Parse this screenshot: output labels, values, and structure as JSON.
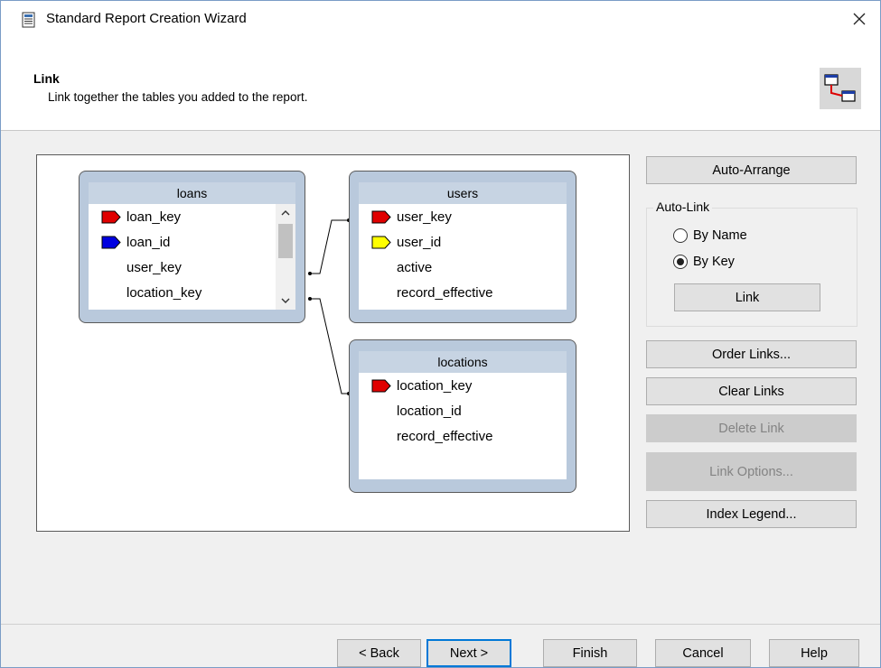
{
  "window": {
    "title": "Standard Report Creation Wizard"
  },
  "header": {
    "title": "Link",
    "subtitle": "Link together the tables you added to the report."
  },
  "tables": [
    {
      "name": "loans",
      "fields": [
        {
          "name": "loan_key",
          "index": "red"
        },
        {
          "name": "loan_id",
          "index": "blue"
        },
        {
          "name": "user_key",
          "index": "none"
        },
        {
          "name": "location_key",
          "index": "none"
        }
      ]
    },
    {
      "name": "users",
      "fields": [
        {
          "name": "user_key",
          "index": "red"
        },
        {
          "name": "user_id",
          "index": "yellow"
        },
        {
          "name": "active",
          "index": "none"
        },
        {
          "name": "record_effective",
          "index": "none"
        }
      ]
    },
    {
      "name": "locations",
      "fields": [
        {
          "name": "location_key",
          "index": "red"
        },
        {
          "name": "location_id",
          "index": "none"
        },
        {
          "name": "record_effective",
          "index": "none"
        }
      ]
    }
  ],
  "index_colors": {
    "red": "#e00000",
    "blue": "#0000e0",
    "yellow": "#ffff00"
  },
  "side_panel": {
    "auto_arrange": "Auto-Arrange",
    "auto_link_label": "Auto-Link",
    "by_name": "By Name",
    "by_key": "By Key",
    "selected": "By Key",
    "link": "Link",
    "order_links": "Order Links...",
    "clear_links": "Clear Links",
    "delete_link": "Delete Link",
    "link_options": "Link Options...",
    "index_legend": "Index Legend..."
  },
  "footer": {
    "back": "< Back",
    "next": "Next >",
    "finish": "Finish",
    "cancel": "Cancel",
    "help": "Help"
  }
}
